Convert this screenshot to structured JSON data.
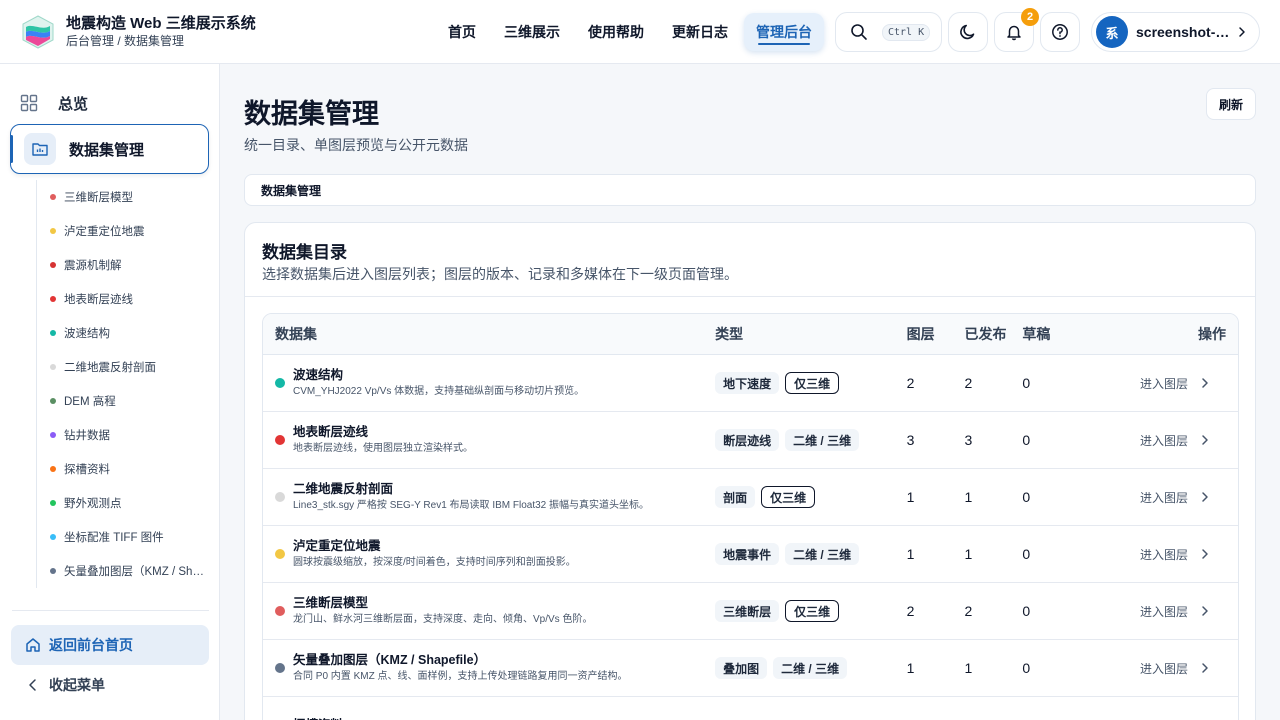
{
  "header": {
    "app_title": "地震构造 Web 三维展示系统",
    "breadcrumb": "后台管理 / 数据集管理",
    "nav": [
      "首页",
      "三维展示",
      "使用帮助",
      "更新日志",
      "管理后台"
    ],
    "active_nav": "管理后台",
    "search_shortcut": "Ctrl K",
    "notification_count": "2",
    "user_initial": "系",
    "user_name": "screenshot-admin",
    "icons": [
      "search-icon",
      "moon-icon",
      "bell-icon",
      "help-icon",
      "chevron-right-icon"
    ]
  },
  "sidebar": {
    "overview": "总览",
    "active": "数据集管理",
    "items": [
      {
        "label": "三维断层模型",
        "color": "#e05d5d"
      },
      {
        "label": "泸定重定位地震",
        "color": "#f2c744"
      },
      {
        "label": "震源机制解",
        "color": "#d63333"
      },
      {
        "label": "地表断层迹线",
        "color": "#e23535"
      },
      {
        "label": "波速结构",
        "color": "#14b8a6"
      },
      {
        "label": "二维地震反射剖面",
        "color": "#d9d9d9"
      },
      {
        "label": "DEM 高程",
        "color": "#5a8f63"
      },
      {
        "label": "钻井数据",
        "color": "#8b5cf6"
      },
      {
        "label": "探槽资料",
        "color": "#f97316"
      },
      {
        "label": "野外观测点",
        "color": "#22c55e"
      },
      {
        "label": "坐标配准 TIFF 图件",
        "color": "#38bdf8"
      },
      {
        "label": "矢量叠加图层（KMZ / Shapefile）",
        "color": "#64748b"
      }
    ],
    "home": "返回前台首页",
    "collapse": "收起菜单"
  },
  "main": {
    "title": "数据集管理",
    "subtitle": "统一目录、单图层预览与公开元数据",
    "refresh": "刷新",
    "crumb": "数据集管理",
    "card_title": "数据集目录",
    "card_subtitle": "选择数据集后进入图层列表；图层的版本、记录和多媒体在下一级页面管理。",
    "columns": [
      "数据集",
      "类型",
      "图层",
      "已发布",
      "草稿",
      "操作"
    ],
    "rows": [
      {
        "title": "波速结构",
        "desc": "CVM_YHJ2022 Vp/Vs 体数据，支持基础纵剖面与移动切片预览。",
        "color": "#14b8a6",
        "type": "地下速度",
        "dim": "仅三维",
        "dim_outline": true,
        "layers": "2",
        "published": "2",
        "draft": "0",
        "op": "进入图层"
      },
      {
        "title": "地表断层迹线",
        "desc": "地表断层迹线，使用图层独立渲染样式。",
        "color": "#e23535",
        "type": "断层迹线",
        "dim": "二维 / 三维",
        "dim_outline": false,
        "layers": "3",
        "published": "3",
        "draft": "0",
        "op": "进入图层"
      },
      {
        "title": "二维地震反射剖面",
        "desc": "Line3_stk.sgy 严格按 SEG-Y Rev1 布局读取 IBM Float32 振幅与真实道头坐标。",
        "color": "#d9d9d9",
        "type": "剖面",
        "dim": "仅三维",
        "dim_outline": true,
        "layers": "1",
        "published": "1",
        "draft": "0",
        "op": "进入图层"
      },
      {
        "title": "泸定重定位地震",
        "desc": "圆球按震级缩放，按深度/时间着色，支持时间序列和剖面投影。",
        "color": "#f2c744",
        "type": "地震事件",
        "dim": "二维 / 三维",
        "dim_outline": false,
        "layers": "1",
        "published": "1",
        "draft": "0",
        "op": "进入图层"
      },
      {
        "title": "三维断层模型",
        "desc": "龙门山、鲜水河三维断层面，支持深度、走向、倾角、Vp/Vs 色阶。",
        "color": "#e05d5d",
        "type": "三维断层",
        "dim": "仅三维",
        "dim_outline": true,
        "layers": "2",
        "published": "2",
        "draft": "0",
        "op": "进入图层"
      },
      {
        "title": "矢量叠加图层（KMZ / Shapefile）",
        "desc": "合同 P0 内置 KMZ 点、线、面样例，支持上传处理链路复用同一资产结构。",
        "color": "#64748b",
        "type": "叠加图",
        "dim": "二维 / 三维",
        "dim_outline": false,
        "layers": "1",
        "published": "1",
        "draft": "0",
        "op": "进入图层"
      },
      {
        "title": "探槽资料",
        "desc": "",
        "color": "#f97316",
        "type": "",
        "dim": "",
        "dim_outline": false,
        "layers": "",
        "published": "",
        "draft": "",
        "op": ""
      }
    ]
  }
}
